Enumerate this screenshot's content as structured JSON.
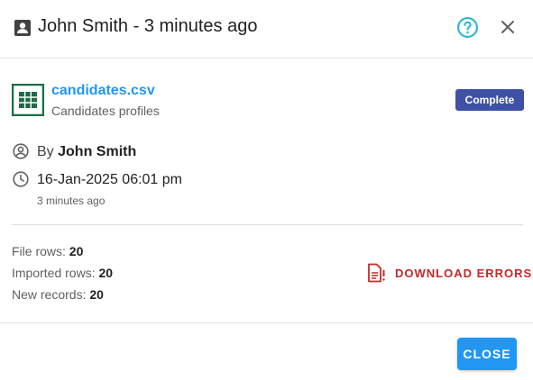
{
  "header": {
    "title": "John Smith - 3 minutes ago",
    "person_icon": "person-badge-icon",
    "help_icon": "help-circle-icon",
    "close_icon": "close-icon"
  },
  "file": {
    "name": "candidates.csv",
    "description": "Candidates profiles",
    "icon": "spreadsheet-icon",
    "status": "Complete"
  },
  "meta": {
    "by_prefix": "By",
    "by_name": "John Smith",
    "date": "16-Jan-2025 06:01 pm",
    "ago": "3 minutes ago"
  },
  "stats": {
    "file_rows_label": "File rows:",
    "file_rows_value": "20",
    "imported_rows_label": "Imported rows:",
    "imported_rows_value": "20",
    "new_records_label": "New records:",
    "new_records_value": "20"
  },
  "actions": {
    "download_errors_label": "DOWNLOAD ERRORS",
    "close_label": "CLOSE"
  },
  "colors": {
    "link_blue": "#2196f3",
    "badge_indigo": "#3f51a4",
    "error_red": "#c62828",
    "help_cyan": "#29b6d8",
    "spreadsheet_green": "#1e6b45"
  }
}
